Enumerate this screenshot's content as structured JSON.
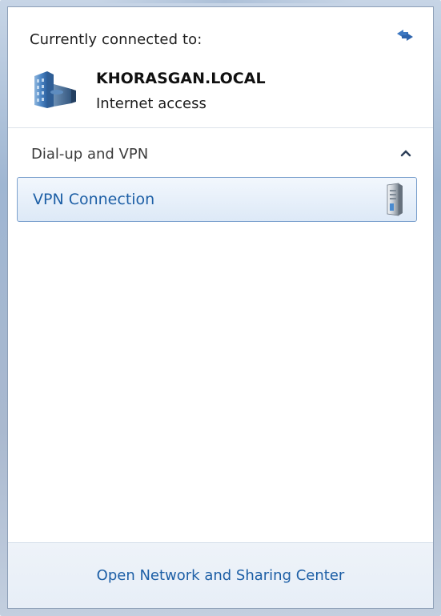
{
  "header": {
    "connected_label": "Currently connected to:",
    "network_name": "KHORASGAN.LOCAL",
    "network_status": "Internet access"
  },
  "section": {
    "title": "Dial-up and VPN",
    "collapse_icon": "chevron-up-icon"
  },
  "connections": [
    {
      "label": "VPN Connection",
      "icon": "vpn-server-icon"
    }
  ],
  "footer": {
    "link_label": "Open Network and Sharing Center"
  },
  "colors": {
    "link": "#1d5fa6",
    "selection_border": "#7da2ce",
    "selection_fill": "#dde9f7",
    "footer_bg": "#eef3f9"
  }
}
